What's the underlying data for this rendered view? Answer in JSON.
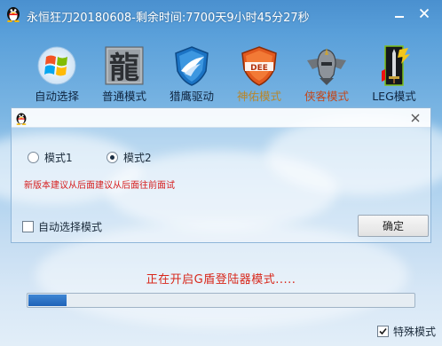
{
  "window": {
    "title": "永恒狂刀20180608-剩余时间:7700天9小时45分27秒"
  },
  "toolbar": {
    "items": [
      {
        "label": "自动选择",
        "icon": "windows-logo-icon",
        "color": "#0f2540"
      },
      {
        "label": "普通模式",
        "icon": "dragon-glyph-icon",
        "color": "#0f2540"
      },
      {
        "label": "猎鹰驱动",
        "icon": "shield-eagle-icon",
        "color": "#0f2540"
      },
      {
        "label": "神佑模式",
        "icon": "dee-shield-icon",
        "color": "#b8862a"
      },
      {
        "label": "侠客模式",
        "icon": "winged-helmet-icon",
        "color": "#c2471b"
      },
      {
        "label": "LEG模式",
        "icon": "leg-sword-icon",
        "color": "#0f2540"
      }
    ]
  },
  "dialog": {
    "radio_mode1": "模式1",
    "radio_mode2": "模式2",
    "selected_mode": "模式2",
    "notice": "新版本建议从后面建议从后面往前面试",
    "auto_select_label": "自动选择模式",
    "auto_select_checked": false,
    "ok_label": "确定"
  },
  "status": {
    "text": "正在开启G盾登陆器模式....."
  },
  "progress": {
    "value_percent": 10
  },
  "special_mode": {
    "label": "特殊模式",
    "checked": true
  },
  "colors": {
    "accent_red": "#d61f1f",
    "progress_blue": "#2a6fc4",
    "sky_top": "#4a90cf"
  }
}
